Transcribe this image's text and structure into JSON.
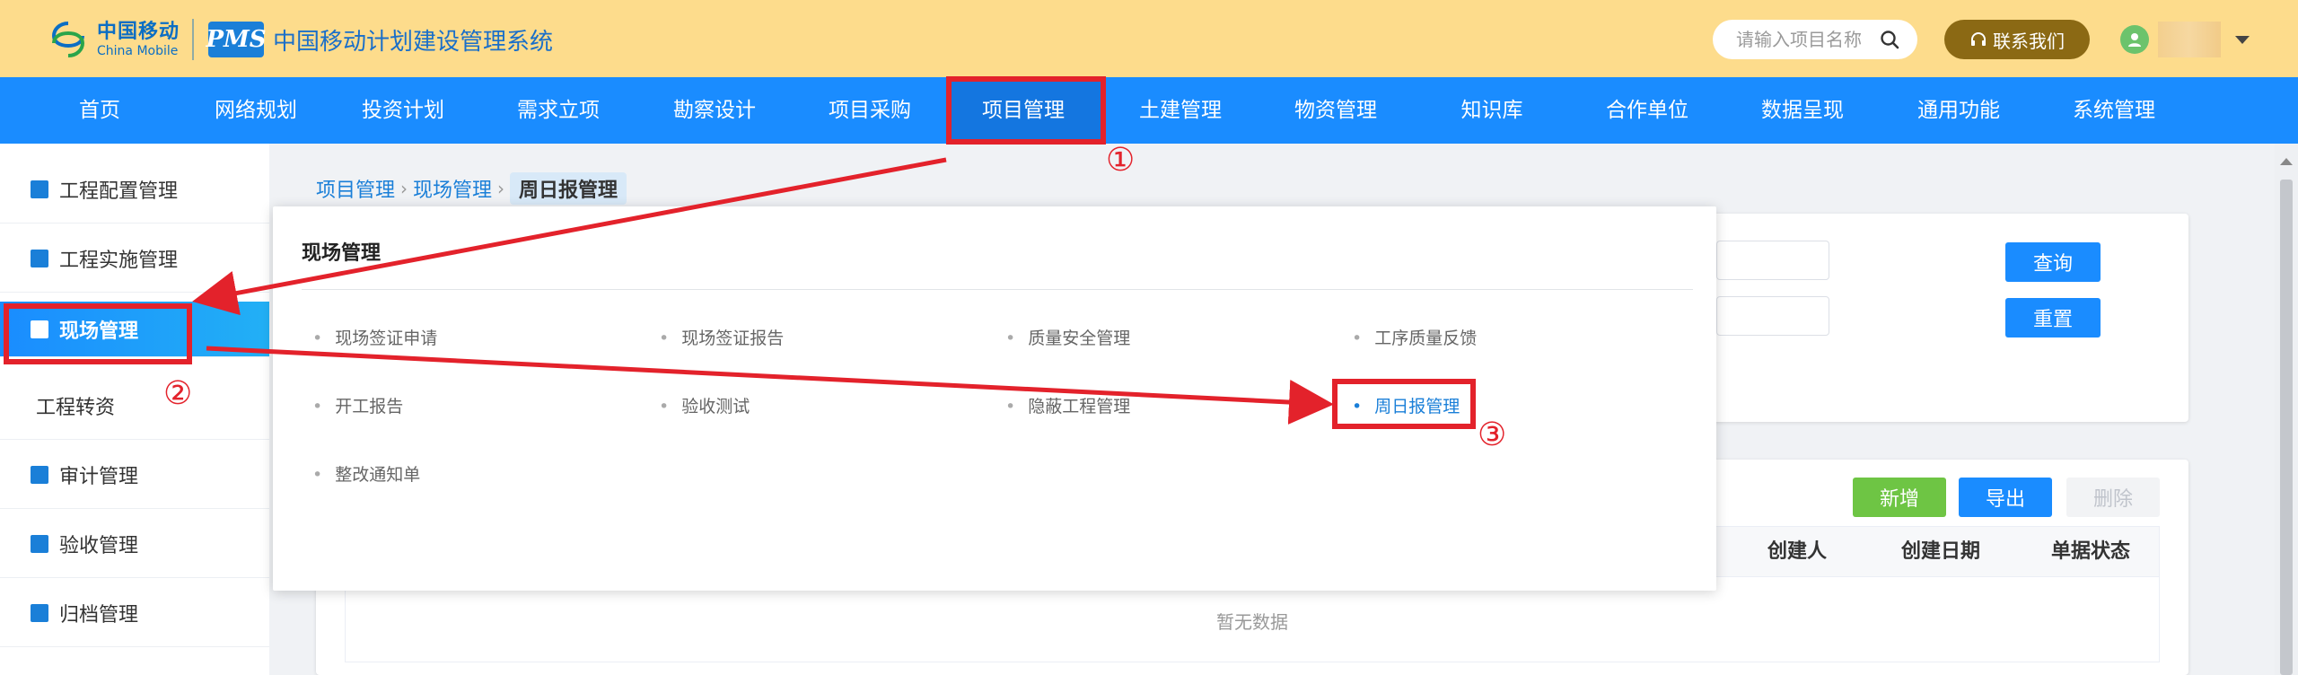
{
  "header": {
    "brand_cn": "中国移动",
    "brand_en": "China Mobile",
    "system_logo": "PMS",
    "system_title": "中国移动计划建设管理系统",
    "search_placeholder": "请输入项目名称",
    "contact_label": "联系我们",
    "brand_color": "#0b6ec4",
    "header_bg": "#fddc8c"
  },
  "nav": {
    "items": [
      "首页",
      "网络规划",
      "投资计划",
      "需求立项",
      "勘察设计",
      "项目采购",
      "项目管理",
      "土建管理",
      "物资管理",
      "知识库",
      "合作单位",
      "数据呈现",
      "通用功能",
      "系统管理"
    ],
    "active": "项目管理",
    "bg": "#1a8cff"
  },
  "sidebar": {
    "items": [
      {
        "label": "工程配置管理",
        "icon": "gear-card-icon"
      },
      {
        "label": "工程实施管理",
        "icon": "tools-icon"
      },
      {
        "label": "现场管理",
        "icon": "camera-icon"
      },
      {
        "label": "工程转资",
        "icon": ""
      },
      {
        "label": "审计管理",
        "icon": "grid-icon"
      },
      {
        "label": "验收管理",
        "icon": "flag-icon"
      },
      {
        "label": "归档管理",
        "icon": "document-icon"
      }
    ],
    "active": "现场管理"
  },
  "breadcrumb": [
    "项目管理",
    "现场管理",
    "周日报管理"
  ],
  "filters": {
    "query_label": "查询",
    "reset_label": "重置"
  },
  "toolbar": {
    "add_label": "新增",
    "export_label": "导出",
    "delete_label": "删除"
  },
  "table": {
    "columns": [
      "创建人",
      "创建日期",
      "单据状态"
    ],
    "empty_text": "暂无数据"
  },
  "mega_menu": {
    "title": "现场管理",
    "links": [
      "现场签证申请",
      "现场签证报告",
      "质量安全管理",
      "工序质量反馈",
      "开工报告",
      "验收测试",
      "隐蔽工程管理",
      "周日报管理",
      "整改通知单"
    ],
    "highlighted": "周日报管理"
  },
  "annotations": {
    "step1": "①",
    "step2": "②",
    "step3": "③",
    "color": "#e3222b"
  }
}
